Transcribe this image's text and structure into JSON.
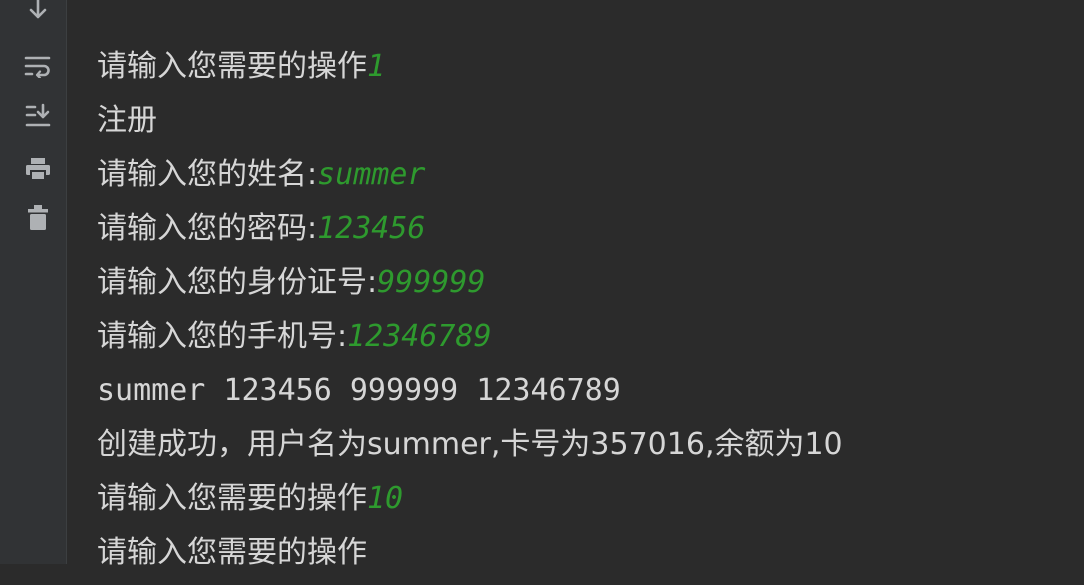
{
  "toolbar": {
    "icons": [
      "arrow-down-icon",
      "soft-wrap-icon",
      "scroll-to-end-icon",
      "print-icon",
      "trash-icon"
    ]
  },
  "colors": {
    "background": "#2b2b2b",
    "gutter": "#313335",
    "text": "#d6d6d6",
    "user_input": "#2e9a2e",
    "icon": "#aeb1b4"
  },
  "console": {
    "lines": [
      {
        "text": "请输入您需要的操作",
        "input": "1"
      },
      {
        "text": "注册",
        "input": ""
      },
      {
        "text": "请输入您的姓名:",
        "input": "summer"
      },
      {
        "text": "请输入您的密码:",
        "input": "123456"
      },
      {
        "text": "请输入您的身份证号:",
        "input": "999999"
      },
      {
        "text": "请输入您的手机号:",
        "input": "12346789"
      },
      {
        "text": "summer 123456 999999 12346789",
        "input": ""
      },
      {
        "text": "创建成功，用户名为summer,卡号为357016,余额为10",
        "input": ""
      },
      {
        "text": "请输入您需要的操作",
        "input": "10"
      },
      {
        "text": "请输入您需要的操作",
        "input": ""
      }
    ]
  }
}
